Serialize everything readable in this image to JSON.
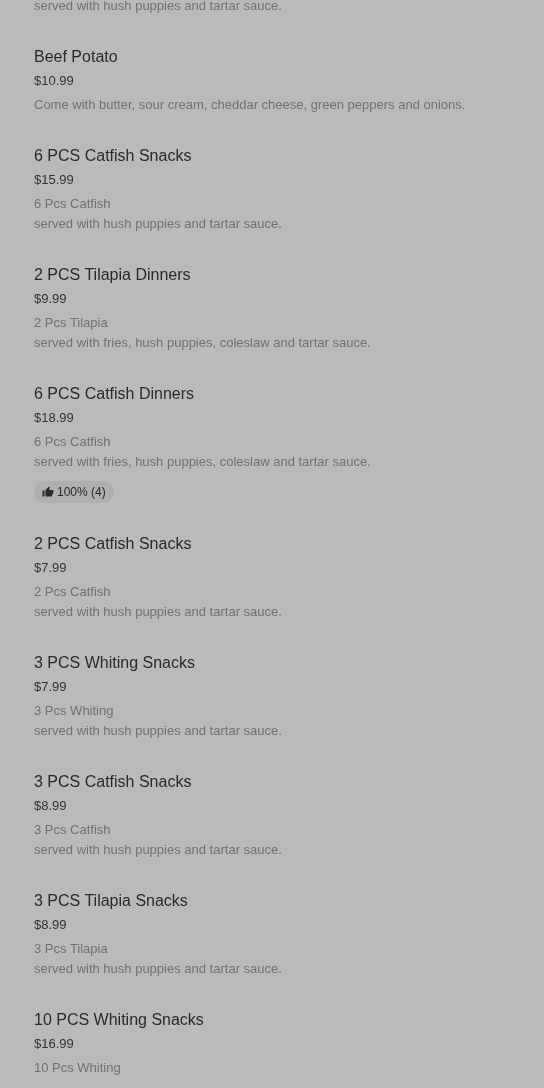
{
  "items": [
    {
      "description": [
        "served with hush puppies and tartar sauce."
      ]
    },
    {
      "name": "Beef Potato",
      "price": "$10.99",
      "description": [
        "Come with butter, sour cream, cheddar cheese, green peppers and onions."
      ]
    },
    {
      "name": "6 PCS Catfish Snacks",
      "price": "$15.99",
      "description": [
        "6 Pcs Catfish",
        "served with hush puppies and tartar sauce."
      ]
    },
    {
      "name": "2 PCS Tilapia Dinners",
      "price": "$9.99",
      "description": [
        "2 Pcs Tilapia",
        "served with fries, hush puppies, coleslaw and tartar sauce."
      ]
    },
    {
      "name": "6 PCS Catfish Dinners",
      "price": "$18.99",
      "description": [
        "6 Pcs Catfish",
        "served with fries, hush puppies, coleslaw and tartar sauce."
      ],
      "rating": "100% (4)"
    },
    {
      "name": "2 PCS Catfish Snacks",
      "price": "$7.99",
      "description": [
        "2 Pcs Catfish",
        "served with hush puppies and tartar sauce."
      ]
    },
    {
      "name": "3 PCS Whiting Snacks",
      "price": "$7.99",
      "description": [
        "3 Pcs Whiting",
        "served with hush puppies and tartar sauce."
      ]
    },
    {
      "name": "3 PCS Catfish Snacks",
      "price": "$8.99",
      "description": [
        "3 Pcs Catfish",
        "served with hush puppies and tartar sauce."
      ]
    },
    {
      "name": "3 PCS Tilapia Snacks",
      "price": "$8.99",
      "description": [
        "3 Pcs Tilapia",
        "served with hush puppies and tartar sauce."
      ]
    },
    {
      "name": "10 PCS Whiting Snacks",
      "price": "$16.99",
      "description": [
        "10 Pcs Whiting"
      ]
    }
  ]
}
